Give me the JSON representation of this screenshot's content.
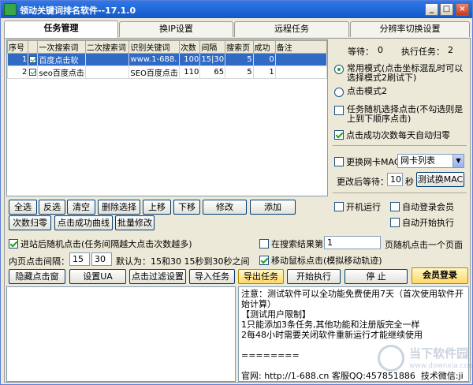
{
  "window": {
    "title": "领动关键词排名软件--17.1.0",
    "controls": [
      "_",
      "□",
      "×"
    ]
  },
  "tabs": [
    {
      "label": "任务管理",
      "active": true
    },
    {
      "label": "换IP设置"
    },
    {
      "label": "远程任务"
    },
    {
      "label": "分辨率切换设置"
    }
  ],
  "table": {
    "headers": [
      "序号",
      "",
      "一次搜索词",
      "二次搜索词",
      "识别关键词",
      "次数",
      "间隔",
      "搜索页",
      "成功",
      "备注"
    ],
    "rows": [
      {
        "no": "1",
        "checked": true,
        "first": "百度点击软",
        "second": "",
        "keyword": "www.1-688.",
        "count": "100",
        "interval": "15|30",
        "page": "5",
        "success": "0",
        "note": "",
        "selected": true
      },
      {
        "no": "2",
        "checked": true,
        "first": "seo百度点击",
        "second": "",
        "keyword": "SEO百度点击",
        "count": "110",
        "interval": "65",
        "page": "5",
        "success": "1",
        "note": "",
        "selected": false
      }
    ]
  },
  "status": {
    "waiting_label": "等待：",
    "waiting_value": "0",
    "running_label": "执行任务：",
    "running_value": "2"
  },
  "modes": {
    "normal": "常用模式(点击坐标混乱时可以选择模式2刷试下)",
    "mode2": "点击模式2"
  },
  "options": {
    "random_click": "任务随机选择点击(不勾选则是上到下顺序点击)",
    "reset_daily": "点击成功次数每天自动归零",
    "change_mac": "更换网卡MAC",
    "nic_select": "网卡列表",
    "wait_label": "更改后等待：",
    "wait_value": "10",
    "wait_unit": "秒",
    "test_mac": "测试换MAC",
    "autostart": "开机运行",
    "auto_login": "自动登录会员",
    "auto_exec": "自动开始执行"
  },
  "buttons_row1": [
    "全选",
    "反选",
    "清空",
    "删除选择",
    "上移",
    "下移",
    "修改",
    "添加"
  ],
  "buttons_row2": [
    "次数归零",
    "点击成功曲线",
    "批量修改"
  ],
  "settings": {
    "random_in_site": "进站后随机点击(任务间隔越大点击次数越多)",
    "inner_interval_label": "内页点击间隔：",
    "inner_min": "15",
    "inner_max": "30",
    "inner_default": "默认为：15和30  15秒到30秒之间",
    "random_result_label": "在搜索结果第",
    "random_result_value": "1",
    "random_result_suffix": "页随机点击一个页面",
    "mouse_move": "移动鼠标点击(模拟移动轨迹)"
  },
  "toolbar": [
    "隐藏点击窗",
    "设置UA",
    "点击过滤设置",
    "导入任务",
    "导出任务",
    "开始执行",
    "停 止",
    "会员登录"
  ],
  "info": {
    "lines": [
      "注意：测试软件可以全功能免费使用7天（首次使用软件开始计算）",
      "【测试用户限制】",
      "1只能添加3条任务,其他功能和注册版完全一样",
      "2每48小时需要关闭软件重新运行才能继续使用",
      "",
      "========",
      "",
      "官网: http://1-688.cn 客服QQ:457851886  技术微信:jiuming995"
    ]
  },
  "watermark": {
    "line1": "当下软件园",
    "line2": "www.downxia.com"
  }
}
